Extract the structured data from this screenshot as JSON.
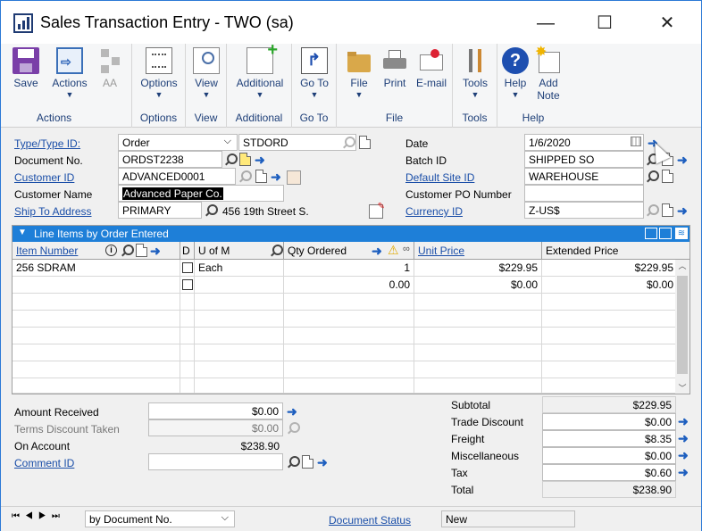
{
  "window": {
    "title": "Sales Transaction Entry  -  TWO (sa)",
    "minimize": "—",
    "maximize": "☐",
    "close": "✕"
  },
  "ribbon": {
    "groups": [
      {
        "label": "Actions",
        "buttons": [
          "Save",
          "Actions",
          "AA"
        ]
      },
      {
        "label": "Options",
        "buttons": [
          "Options"
        ]
      },
      {
        "label": "View",
        "buttons": [
          "View"
        ]
      },
      {
        "label": "Additional",
        "buttons": [
          "Additional"
        ]
      },
      {
        "label": "Go To",
        "buttons": [
          "Go To"
        ]
      },
      {
        "label": "File",
        "buttons": [
          "File",
          "Print",
          "E-mail"
        ]
      },
      {
        "label": "Tools",
        "buttons": [
          "Tools"
        ]
      },
      {
        "label": "Help",
        "buttons": [
          "Help",
          "Add Note"
        ]
      }
    ],
    "add_note_line1": "Add",
    "add_note_line2": "Note"
  },
  "header": {
    "type_label": "Type/Type ID:",
    "type_value": "Order",
    "type_id_value": "STDORD",
    "docno_label": "Document No.",
    "docno_value": "ORDST2238",
    "customer_id_label": "Customer ID",
    "customer_id_value": "ADVANCED0001",
    "customer_name_label": "Customer Name",
    "customer_name_value": "Advanced Paper Co.",
    "ship_to_label": "Ship To Address",
    "ship_to_value": "PRIMARY",
    "ship_to_address": "456 19th Street S.",
    "date_label": "Date",
    "date_value": "1/6/2020",
    "batch_label": "Batch ID",
    "batch_value": "SHIPPED SO",
    "site_label": "Default Site ID",
    "site_value": "WAREHOUSE",
    "po_label": "Customer PO Number",
    "po_value": "",
    "currency_label": "Currency ID",
    "currency_value": "Z-US$"
  },
  "grid": {
    "title": "Line Items by Order Entered",
    "columns": [
      "Item Number",
      "D",
      "U of M",
      "Qty Ordered",
      "Unit Price",
      "Extended Price"
    ],
    "rows": [
      {
        "item": "256 SDRAM",
        "uom": "Each",
        "qty": "1",
        "unit_price": "$229.95",
        "ext_price": "$229.95"
      },
      {
        "item": "",
        "uom": "",
        "qty": "0.00",
        "unit_price": "$0.00",
        "ext_price": "$0.00"
      }
    ]
  },
  "payments": {
    "amount_received_label": "Amount Received",
    "amount_received_value": "$0.00",
    "terms_discount_label": "Terms Discount Taken",
    "terms_discount_value": "$0.00",
    "on_account_label": "On Account",
    "on_account_value": "$238.90",
    "comment_label": "Comment ID",
    "comment_value": ""
  },
  "totals": [
    {
      "label": "Subtotal",
      "value": "$229.95"
    },
    {
      "label": "Trade Discount",
      "value": "$0.00"
    },
    {
      "label": "Freight",
      "value": "$8.35"
    },
    {
      "label": "Miscellaneous",
      "value": "$0.00"
    },
    {
      "label": "Tax",
      "value": "$0.60"
    },
    {
      "label": "Total",
      "value": "$238.90"
    }
  ],
  "statusbar": {
    "sort_value": "by Document No.",
    "doc_status_label": "Document Status",
    "doc_status_value": "New"
  },
  "colors": {
    "accent": "#1e7fd8",
    "link": "#1a4ea8",
    "window_border": "#2b79d6"
  }
}
